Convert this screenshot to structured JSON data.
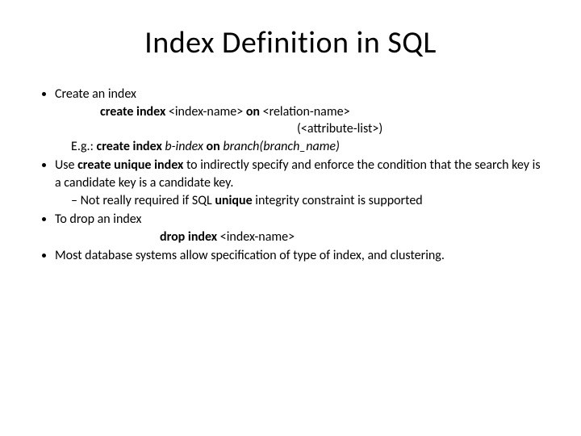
{
  "title": "Index Definition in SQL",
  "bullets": {
    "b1": "Create an index",
    "syntax1_pre": "create index ",
    "syntax1_mid": "<index-name>",
    "syntax1_on": " on ",
    "syntax1_rel": "<relation-name>",
    "syntax2": "(<attribute-list>)",
    "eg_label": "E.g.:  ",
    "eg_ci": "create index",
    "eg_name": "  b-index ",
    "eg_on": "on ",
    "eg_rel": "branch(branch_name)",
    "b2a": "Use ",
    "b2b": "create unique index",
    "b2c": " to indirectly specify and enforce the condition that the search key is a candidate key is a candidate key.",
    "b2_sub_a": "Not really required if SQL ",
    "b2_sub_b": "unique",
    "b2_sub_c": " integrity constraint is supported",
    "b3": "To drop an index",
    "drop_pre": "drop index ",
    "drop_arg": "<index-name>",
    "b4": "Most database systems allow specification of type of index, and clustering."
  }
}
